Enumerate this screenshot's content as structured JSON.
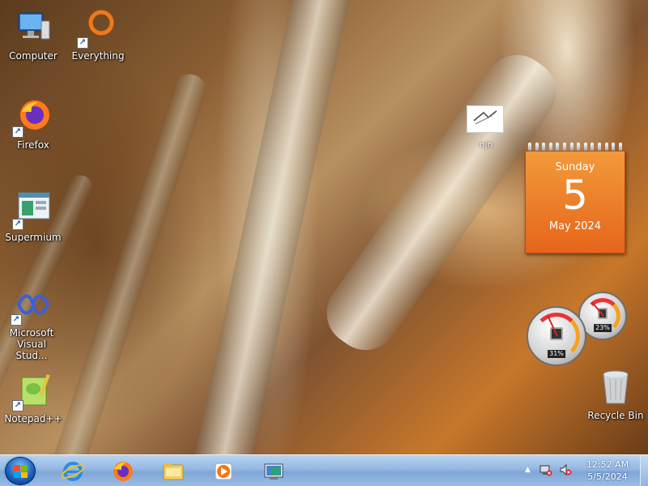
{
  "desktop": {
    "icons": [
      {
        "label": "Computer",
        "icon": "computer-icon"
      },
      {
        "label": "Everything",
        "icon": "everything-search-icon"
      },
      {
        "label": "Firefox",
        "icon": "firefox-icon"
      },
      {
        "label": "Supermium",
        "icon": "supermium-icon"
      },
      {
        "label": "Microsoft Visual Stud...",
        "icon": "visual-studio-icon"
      },
      {
        "label": "Notepad++",
        "icon": "notepad-plus-plus-icon"
      },
      {
        "label": "Recycle Bin",
        "icon": "recycle-bin-icon"
      }
    ],
    "stray_item": {
      "label": "njn",
      "icon": "image-file-icon"
    }
  },
  "calendar_gadget": {
    "day_of_week": "Sunday",
    "day": "5",
    "month_year": "May 2024"
  },
  "cpu_meter_gadget": {
    "cpu_usage": "31%",
    "memory_usage": "23%"
  },
  "taskbar": {
    "start_icon": "windows-start-orb-icon",
    "pinned": [
      {
        "name": "Internet Explorer",
        "icon": "internet-explorer-icon"
      },
      {
        "name": "Firefox",
        "icon": "firefox-icon"
      },
      {
        "name": "File Explorer",
        "icon": "folder-icon"
      },
      {
        "name": "Media Player",
        "icon": "media-player-icon"
      },
      {
        "name": "Remote Desktop",
        "icon": "remote-desktop-icon"
      }
    ],
    "tray": {
      "chevron": "▲",
      "clock_time": "12:52 AM",
      "clock_date": "5/5/2024"
    }
  },
  "colors": {
    "calendar_orange": "#e8701e",
    "taskbar_blue": "#93b7e2"
  }
}
